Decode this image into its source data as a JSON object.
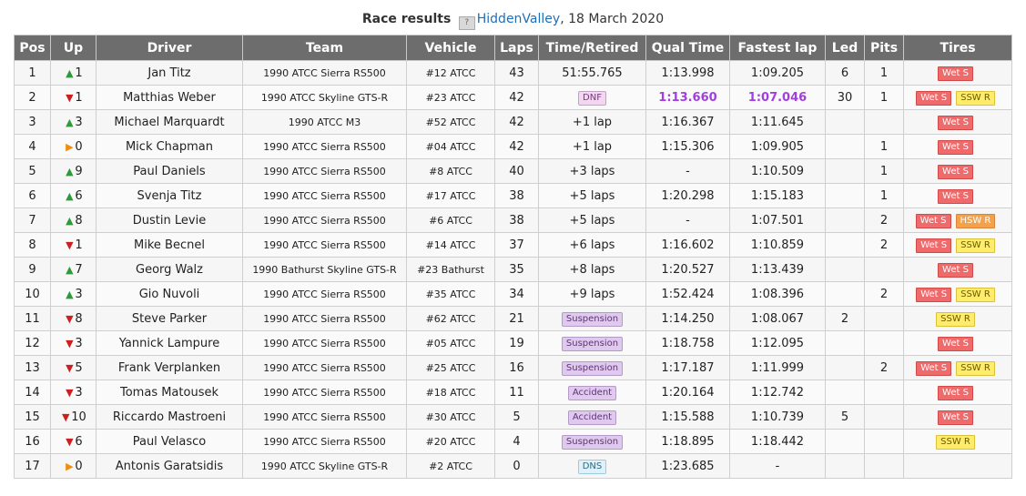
{
  "caption": {
    "label": "Race results",
    "track": "HiddenValley",
    "date": ", 18 March 2020"
  },
  "columns": [
    "Pos",
    "Up",
    "Driver",
    "Team",
    "Vehicle",
    "Laps",
    "Time/Retired",
    "Qual Time",
    "Fastest lap",
    "Led",
    "Pits",
    "Tires"
  ],
  "rows": [
    {
      "pos": "1",
      "dir": "up",
      "up": "1",
      "driver": "Jan Titz",
      "team": "1990 ATCC Sierra RS500",
      "vehicle": "#12 ATCC",
      "laps": "43",
      "time": "51:55.765",
      "status": "",
      "qual": "1:13.998",
      "fastest": "1:09.205",
      "led": "6",
      "pits": "1",
      "tires": [
        "Wet S"
      ]
    },
    {
      "pos": "2",
      "dir": "dn",
      "up": "1",
      "driver": "Matthias Weber",
      "team": "1990 ATCC Skyline GTS-R",
      "vehicle": "#23 ATCC",
      "laps": "42",
      "time": "",
      "status": "DNF",
      "qual": "1:13.660",
      "fastest": "1:07.046",
      "led": "30",
      "pits": "1",
      "tires": [
        "Wet S",
        "SSW R"
      ],
      "best": true
    },
    {
      "pos": "3",
      "dir": "up",
      "up": "3",
      "driver": "Michael Marquardt",
      "team": "1990 ATCC M3",
      "vehicle": "#52 ATCC",
      "laps": "42",
      "time": "+1 lap",
      "status": "",
      "qual": "1:16.367",
      "fastest": "1:11.645",
      "led": "",
      "pits": "",
      "tires": [
        "Wet S"
      ]
    },
    {
      "pos": "4",
      "dir": "eq",
      "up": "0",
      "driver": "Mick Chapman",
      "team": "1990 ATCC Sierra RS500",
      "vehicle": "#04 ATCC",
      "laps": "42",
      "time": "+1 lap",
      "status": "",
      "qual": "1:15.306",
      "fastest": "1:09.905",
      "led": "",
      "pits": "1",
      "tires": [
        "Wet S"
      ]
    },
    {
      "pos": "5",
      "dir": "up",
      "up": "9",
      "driver": "Paul Daniels",
      "team": "1990 ATCC Sierra RS500",
      "vehicle": "#8 ATCC",
      "laps": "40",
      "time": "+3 laps",
      "status": "",
      "qual": "-",
      "fastest": "1:10.509",
      "led": "",
      "pits": "1",
      "tires": [
        "Wet S"
      ]
    },
    {
      "pos": "6",
      "dir": "up",
      "up": "6",
      "driver": "Svenja Titz",
      "team": "1990 ATCC Sierra RS500",
      "vehicle": "#17 ATCC",
      "laps": "38",
      "time": "+5 laps",
      "status": "",
      "qual": "1:20.298",
      "fastest": "1:15.183",
      "led": "",
      "pits": "1",
      "tires": [
        "Wet S"
      ]
    },
    {
      "pos": "7",
      "dir": "up",
      "up": "8",
      "driver": "Dustin Levie",
      "team": "1990 ATCC Sierra RS500",
      "vehicle": "#6 ATCC",
      "laps": "38",
      "time": "+5 laps",
      "status": "",
      "qual": "-",
      "fastest": "1:07.501",
      "led": "",
      "pits": "2",
      "tires": [
        "Wet S",
        "HSW R"
      ]
    },
    {
      "pos": "8",
      "dir": "dn",
      "up": "1",
      "driver": "Mike Becnel",
      "team": "1990 ATCC Sierra RS500",
      "vehicle": "#14 ATCC",
      "laps": "37",
      "time": "+6 laps",
      "status": "",
      "qual": "1:16.602",
      "fastest": "1:10.859",
      "led": "",
      "pits": "2",
      "tires": [
        "Wet S",
        "SSW R"
      ]
    },
    {
      "pos": "9",
      "dir": "up",
      "up": "7",
      "driver": "Georg Walz",
      "team": "1990 Bathurst Skyline GTS-R",
      "vehicle": "#23 Bathurst",
      "laps": "35",
      "time": "+8 laps",
      "status": "",
      "qual": "1:20.527",
      "fastest": "1:13.439",
      "led": "",
      "pits": "",
      "tires": [
        "Wet S"
      ]
    },
    {
      "pos": "10",
      "dir": "up",
      "up": "3",
      "driver": "Gio Nuvoli",
      "team": "1990 ATCC Sierra RS500",
      "vehicle": "#35 ATCC",
      "laps": "34",
      "time": "+9 laps",
      "status": "",
      "qual": "1:52.424",
      "fastest": "1:08.396",
      "led": "",
      "pits": "2",
      "tires": [
        "Wet S",
        "SSW R"
      ]
    },
    {
      "pos": "11",
      "dir": "dn",
      "up": "8",
      "driver": "Steve Parker",
      "team": "1990 ATCC Sierra RS500",
      "vehicle": "#62 ATCC",
      "laps": "21",
      "time": "",
      "status": "Suspension",
      "qual": "1:14.250",
      "fastest": "1:08.067",
      "led": "2",
      "pits": "",
      "tires": [
        "SSW R"
      ]
    },
    {
      "pos": "12",
      "dir": "dn",
      "up": "3",
      "driver": "Yannick Lampure",
      "team": "1990 ATCC Sierra RS500",
      "vehicle": "#05 ATCC",
      "laps": "19",
      "time": "",
      "status": "Suspension",
      "qual": "1:18.758",
      "fastest": "1:12.095",
      "led": "",
      "pits": "",
      "tires": [
        "Wet S"
      ]
    },
    {
      "pos": "13",
      "dir": "dn",
      "up": "5",
      "driver": "Frank Verplanken",
      "team": "1990 ATCC Sierra RS500",
      "vehicle": "#25 ATCC",
      "laps": "16",
      "time": "",
      "status": "Suspension",
      "qual": "1:17.187",
      "fastest": "1:11.999",
      "led": "",
      "pits": "2",
      "tires": [
        "Wet S",
        "SSW R"
      ]
    },
    {
      "pos": "14",
      "dir": "dn",
      "up": "3",
      "driver": "Tomas Matousek",
      "team": "1990 ATCC Sierra RS500",
      "vehicle": "#18 ATCC",
      "laps": "11",
      "time": "",
      "status": "Accident",
      "qual": "1:20.164",
      "fastest": "1:12.742",
      "led": "",
      "pits": "",
      "tires": [
        "Wet S"
      ]
    },
    {
      "pos": "15",
      "dir": "dn",
      "up": "10",
      "driver": "Riccardo Mastroeni",
      "team": "1990 ATCC Sierra RS500",
      "vehicle": "#30 ATCC",
      "laps": "5",
      "time": "",
      "status": "Accident",
      "qual": "1:15.588",
      "fastest": "1:10.739",
      "led": "5",
      "pits": "",
      "tires": [
        "Wet S"
      ]
    },
    {
      "pos": "16",
      "dir": "dn",
      "up": "6",
      "driver": "Paul Velasco",
      "team": "1990 ATCC Sierra RS500",
      "vehicle": "#20 ATCC",
      "laps": "4",
      "time": "",
      "status": "Suspension",
      "qual": "1:18.895",
      "fastest": "1:18.442",
      "led": "",
      "pits": "",
      "tires": [
        "SSW R"
      ]
    },
    {
      "pos": "17",
      "dir": "eq",
      "up": "0",
      "driver": "Antonis Garatsidis",
      "team": "1990 ATCC Skyline GTS-R",
      "vehicle": "#2 ATCC",
      "laps": "0",
      "time": "",
      "status": "DNS",
      "qual": "1:23.685",
      "fastest": "-",
      "led": "",
      "pits": "",
      "tires": []
    }
  ],
  "icons": {
    "up": "triangle-up-icon",
    "dn": "triangle-down-icon",
    "eq": "triangle-right-icon",
    "track": "track-map-icon"
  },
  "colors": {
    "up": "#2e9a3a",
    "dn": "#cc2020",
    "eq": "#f08c10",
    "best": "#a23de0",
    "header": "#6d6d6d",
    "wet": "#ef6b6b",
    "ssw": "#ffec6b",
    "hsw": "#f4a24a"
  }
}
